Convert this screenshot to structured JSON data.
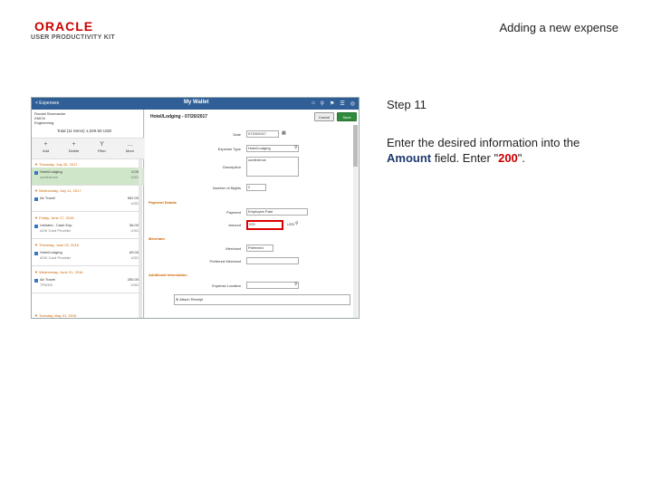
{
  "brand": {
    "logo_text": "ORACLE",
    "logo_sub": "USER PRODUCTIVITY KIT"
  },
  "title": "Adding a new expense",
  "step": "Step 11",
  "instruction": {
    "pre": "Enter the desired information into the ",
    "field_label": "Amount",
    "mid": " field. Enter \"",
    "value": "200",
    "post": "\"."
  },
  "screenshot": {
    "topbar": {
      "back": "< Expenses",
      "title": "My Wallet"
    },
    "user": {
      "name": "Ronald Strumacher",
      "sub1": "KMCN",
      "sub2": "Engineering"
    },
    "total": "Total (11 Items)  1,029.50  USD",
    "toolbar": [
      {
        "icon": "+",
        "label": "Add"
      },
      {
        "icon": "+",
        "label": "Delete"
      },
      {
        "icon": "Y",
        "label": "Filter"
      },
      {
        "icon": "...",
        "label": "More"
      }
    ],
    "groups": [
      {
        "label": "▼ Thursday, July 20, 2017"
      },
      {
        "label": "▼ Wednesday, July 11, 2017"
      },
      {
        "label": "▼ Friday, June 17, 2016"
      },
      {
        "label": "▼ Thursday, June 02, 2016"
      },
      {
        "label": "▼ Wednesday, June 01, 2016"
      },
      {
        "label": "▼ Tuesday, May 31, 2016"
      }
    ],
    "rows": [
      {
        "name": "Hotel/Lodging",
        "desc": "conference",
        "value": "0.00",
        "curr": "USD"
      },
      {
        "name": "Air Travel",
        "desc": "",
        "value": "562.00",
        "curr": "USD"
      },
      {
        "name": "Unlisted - Cash Exp.",
        "desc": "AOK Card Provider",
        "value": "56.00",
        "curr": "USD"
      },
      {
        "name": "Hotel/Lodging",
        "desc": "AOK Card Provider",
        "value": "69.00",
        "curr": "USD"
      },
      {
        "name": "Air Travel",
        "desc": "TP5000",
        "value": "250.00",
        "curr": "USD"
      }
    ],
    "detail": {
      "header": "Hotel/Lodging - 07/20/2017",
      "cancel": "Cancel",
      "save": "Save",
      "date_label": "Date",
      "date_value": "07/20/2017",
      "expense_type_label": "Expense Type",
      "expense_type_value": "Hotel/Lodging",
      "description_label": "Description",
      "description_value": "conference",
      "nights_label": "Number of Nights",
      "nights_value": "2",
      "payment_section": "Payment Details",
      "payment_label": "Payment",
      "payment_value": "Employee Paid",
      "amount_label": "Amount",
      "amount_value": "200",
      "currency": "USD",
      "merchant_section": "Merchant",
      "merchant_label": "Merchant",
      "merchant_value": "Preferred",
      "pref_merchant_label": "Preferred Merchant",
      "additional_section": "Additional Information",
      "location_label": "Expense Location",
      "attach_label": "Attach Receipt"
    }
  }
}
